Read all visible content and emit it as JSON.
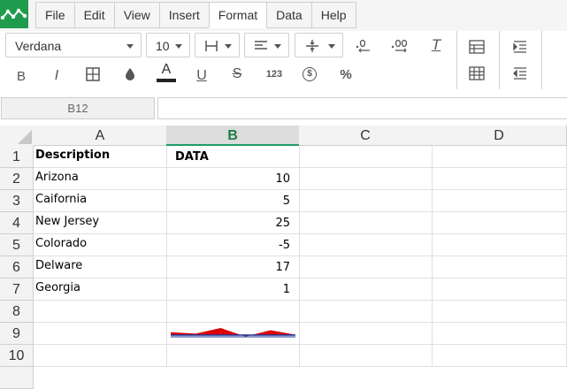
{
  "menu": {
    "items": [
      {
        "label": "File"
      },
      {
        "label": "Edit"
      },
      {
        "label": "View"
      },
      {
        "label": "Insert"
      },
      {
        "label": "Format"
      },
      {
        "label": "Data"
      },
      {
        "label": "Help"
      }
    ],
    "active": "Format"
  },
  "toolbar": {
    "font_family": "Verdana",
    "font_size": "10",
    "icons": {
      "borders": "borders-icon",
      "align": "align-left-icon",
      "valign": "vertical-align-icon",
      "decrease_decimals": "decrease-decimals-icon",
      "increase_decimals": "increase-decimals-icon",
      "clear_format": "clear-format-icon",
      "bold": "bold-icon",
      "italic": "italic-icon",
      "border_style": "border-style-icon",
      "fill_color": "fill-color-icon",
      "text_color": "text-color-icon",
      "underline": "underline-icon",
      "strikethrough": "strikethrough-icon",
      "number_format": "number-format-icon",
      "currency": "currency-icon",
      "percent": "percent-icon",
      "insert_rows": "insert-rows-icon",
      "delete_rows": "delete-rows-icon",
      "indent": "indent-icon",
      "outdent": "outdent-icon"
    },
    "labels": {
      "bold": "B",
      "italic": "I",
      "text_color": "A",
      "underline": "U",
      "strike": "S",
      "number": "123",
      "currency": "$",
      "percent": "%",
      "clear": "T"
    },
    "text_color_swatch": "#222222"
  },
  "formula_bar": {
    "name_box": "B12",
    "formula": ""
  },
  "sheet": {
    "columns": [
      "A",
      "B",
      "C",
      "D"
    ],
    "selected_column": "B",
    "row_numbers": [
      "1",
      "2",
      "3",
      "4",
      "5",
      "6",
      "7",
      "8",
      "9",
      "10"
    ],
    "header_row": {
      "a": "Description",
      "b": "DATA"
    },
    "rows": [
      {
        "a": "Arizona",
        "b": "10"
      },
      {
        "a": "Caifornia",
        "b": "5"
      },
      {
        "a": "New Jersey",
        "b": "25"
      },
      {
        "a": "Colorado",
        "b": "-5"
      },
      {
        "a": "Delware",
        "b": "17"
      },
      {
        "a": "Georgia",
        "b": "1"
      }
    ]
  },
  "sparkline": {
    "cell": "B9",
    "values": [
      10,
      5,
      25,
      -5,
      17,
      1
    ],
    "positive_color": "#dd0000",
    "negative_color": "#1a3399",
    "axis_color": "#1a3399"
  },
  "colors": {
    "accent": "#1f9b4d",
    "selected_header_text": "#1e7b45"
  }
}
